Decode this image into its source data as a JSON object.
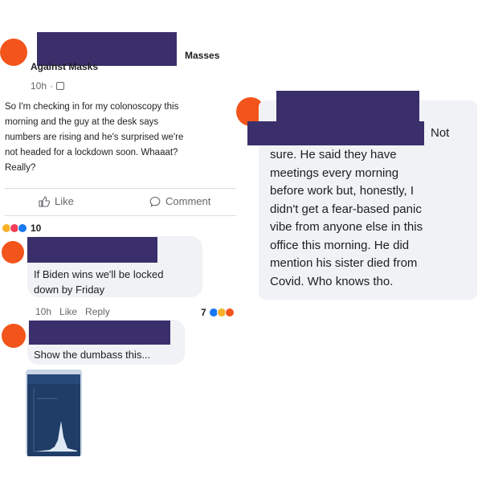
{
  "post": {
    "group_name": "Masses\nAgainst Masks",
    "time": "10h",
    "body": "So I'm checking in for my colonoscopy this\nmorning and the guy at the desk says\nnumbers are rising and he's surprised we're\nnot headed for a lockdown soon.  Whaaat?\nReally?",
    "like_label": "Like",
    "comment_label": "Comment",
    "reaction_count": "10"
  },
  "comments": [
    {
      "text": "If Biden wins we'll be locked\ndown by Friday",
      "time": "10h",
      "like_label": "Like",
      "reply_label": "Reply",
      "reaction_count": "7"
    },
    {
      "text": "Show the dumbass this..."
    }
  ],
  "right_reply": {
    "first_word": "Not",
    "body": "sure.  He said they have\nmeetings every morning\nbefore work but, honestly, I\ndidn't get a fear-based panic\nvibe from anyone else in this\noffice this morning.  He did\nmention his sister died from\nCovid.  Who knows tho."
  },
  "colors": {
    "avatar": "#f2541b",
    "redaction": "#3a2f6b",
    "bubble": "#f0f2f5",
    "like_blue": "#1877f2",
    "love_red": "#f33e58",
    "haha_yellow": "#f7b125"
  }
}
